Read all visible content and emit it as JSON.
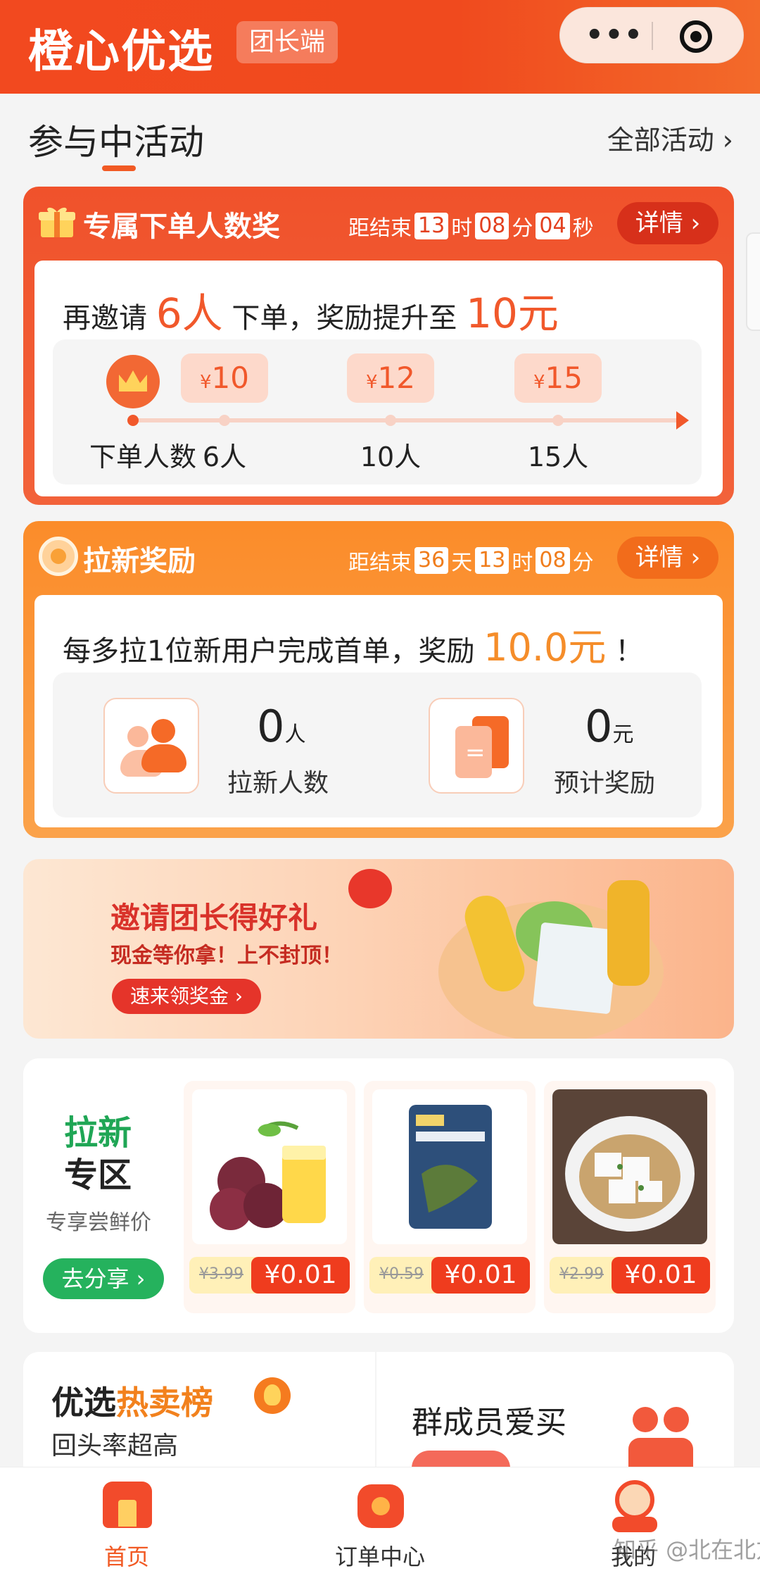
{
  "header": {
    "brand": "橙心优选",
    "badge": "团长端",
    "menu_dots": "•••"
  },
  "section": {
    "title": "参与中活动",
    "all_link": "全部活动 ›"
  },
  "order_reward": {
    "title": "专属下单人数奖",
    "countdown_prefix": "距结束",
    "hours": "13",
    "hours_unit": "时",
    "minutes": "08",
    "minutes_unit": "分",
    "seconds": "04",
    "seconds_unit": "秒",
    "detail_btn": "详情 ›",
    "invite_pre": "再邀请",
    "invite_count": "6人",
    "invite_mid": "下单，奖励提升至",
    "invite_amount": "10元",
    "start_label": "下单人数",
    "tiers": [
      {
        "currency": "¥",
        "amount": "10",
        "label": "6人"
      },
      {
        "currency": "¥",
        "amount": "12",
        "label": "10人"
      },
      {
        "currency": "¥",
        "amount": "15",
        "label": "15人"
      }
    ]
  },
  "new_user_reward": {
    "title": "拉新奖励",
    "countdown_prefix": "距结束",
    "days": "36",
    "days_unit": "天",
    "hours": "13",
    "hours_unit": "时",
    "minutes": "08",
    "minutes_unit": "分",
    "detail_btn": "详情 ›",
    "desc_pre": "每多拉1位新用户完成首单，奖励",
    "desc_amount": "10.0元",
    "desc_post": "！",
    "stats": [
      {
        "value": "0",
        "unit": "人",
        "label": "拉新人数"
      },
      {
        "value": "0",
        "unit": "元",
        "label": "预计奖励"
      }
    ]
  },
  "banner": {
    "title": "邀请团长得好礼",
    "subtitle": "现金等你拿！上不封顶！",
    "button": "速来领奖金 ›"
  },
  "new_zone": {
    "title_line1": "拉新",
    "title_line2": "专区",
    "subtitle": "专享尝鲜价",
    "share_btn": "去分享 ›",
    "products": [
      {
        "old_price": "¥3.99",
        "new_price": "¥0.01"
      },
      {
        "old_price": "¥0.59",
        "new_price": "¥0.01"
      },
      {
        "old_price": "¥2.99",
        "new_price": "¥0.01"
      }
    ]
  },
  "hot_list": {
    "title_pre": "优选",
    "title_hl": "热卖榜",
    "subtitle": "回头率超高"
  },
  "group_fav": {
    "title": "群成员爱买"
  },
  "tabbar": [
    {
      "label": "首页"
    },
    {
      "label": "订单中心"
    },
    {
      "label": "我的"
    }
  ],
  "watermark": "知乎 @北在北方",
  "colors": {
    "brand_orange": "#f04a1e",
    "accent_orange": "#fb8c2a",
    "green": "#25b25d"
  }
}
